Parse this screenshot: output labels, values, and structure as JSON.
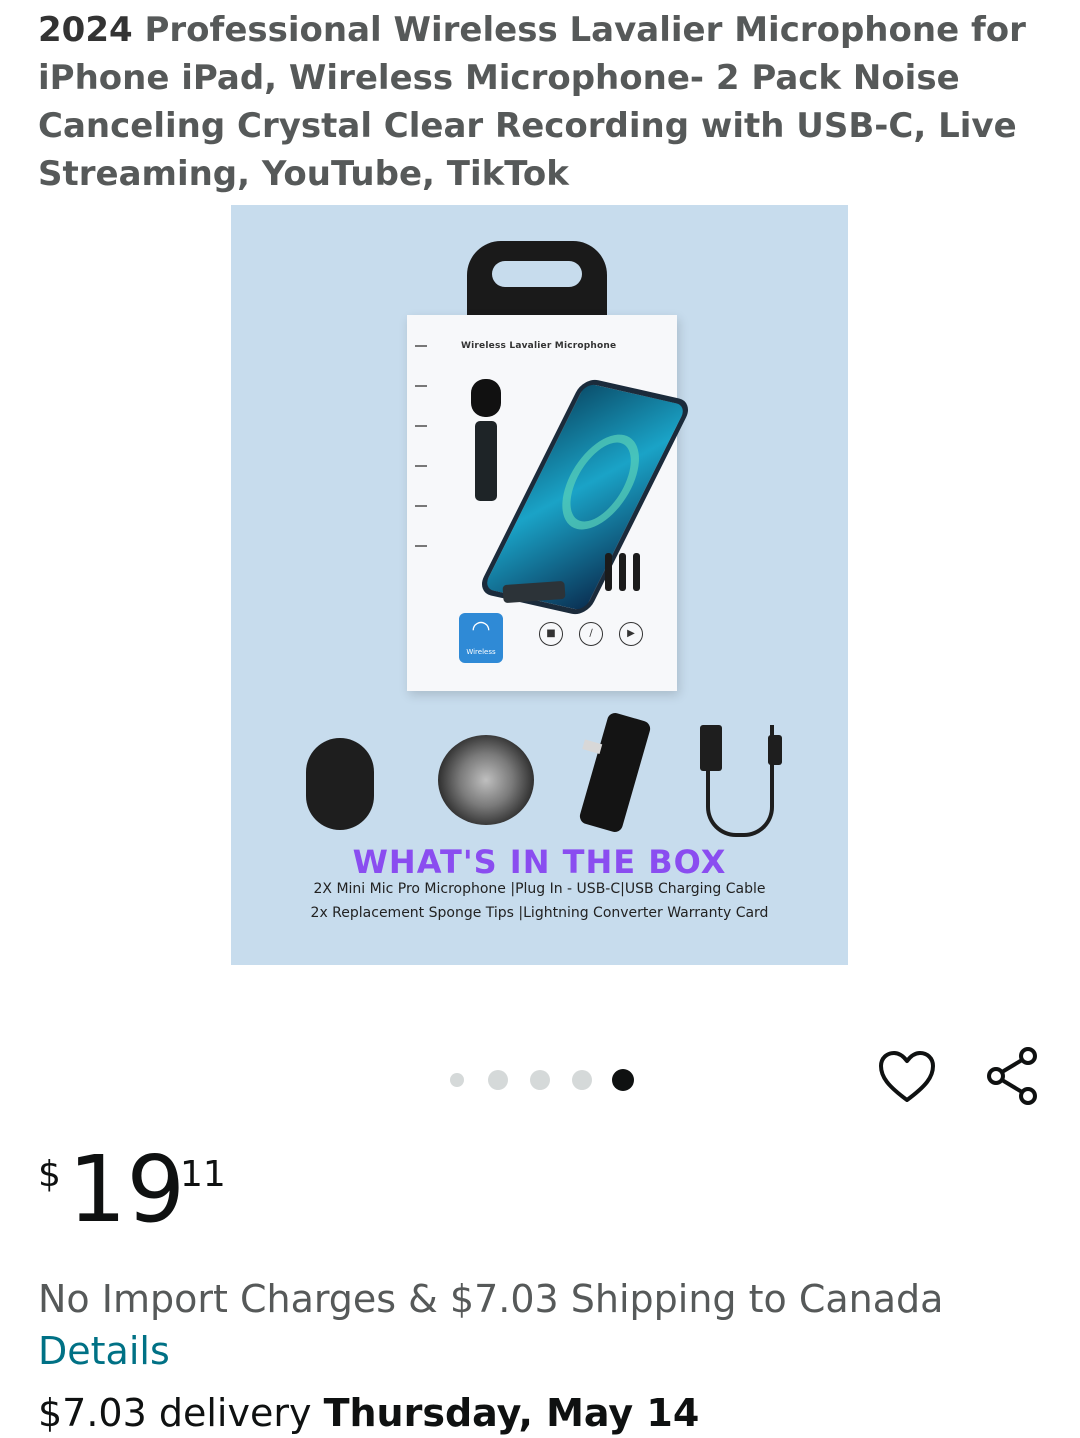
{
  "product": {
    "title_brand": "2024",
    "title_rest": "Professional Wireless Lavalier Microphone for iPhone iPad, Wireless Microphone- 2 Pack Noise Canceling Crystal Clear Recording with USB-C, Live Streaming, YouTube, TikTok"
  },
  "image": {
    "box_label": "Wireless Lavalier Microphone",
    "wifi_badge_label": "Wireless",
    "whats_in_box_title": "WHAT'S IN THE BOX",
    "whats_in_box_line1": "2X Mini Mic Pro Microphone |Plug In - USB-C|USB Charging Cable",
    "whats_in_box_line2": "2x Replacement Sponge Tips |Lightning Converter Warranty Card"
  },
  "carousel": {
    "total": 5,
    "active_index": 4
  },
  "actions": {
    "favorite_icon": "heart-icon",
    "share_icon": "share-icon"
  },
  "price": {
    "currency": "$",
    "whole": "19",
    "fraction": "11"
  },
  "shipping": {
    "text": "No Import Charges & $7.03 Shipping to Canada",
    "details_link": "Details"
  },
  "delivery": {
    "prefix": "$7.03 delivery",
    "date": "Thursday, May 14"
  },
  "colors": {
    "link": "#007185",
    "accent_purple": "#8a4df0",
    "image_background": "#c7dced"
  }
}
